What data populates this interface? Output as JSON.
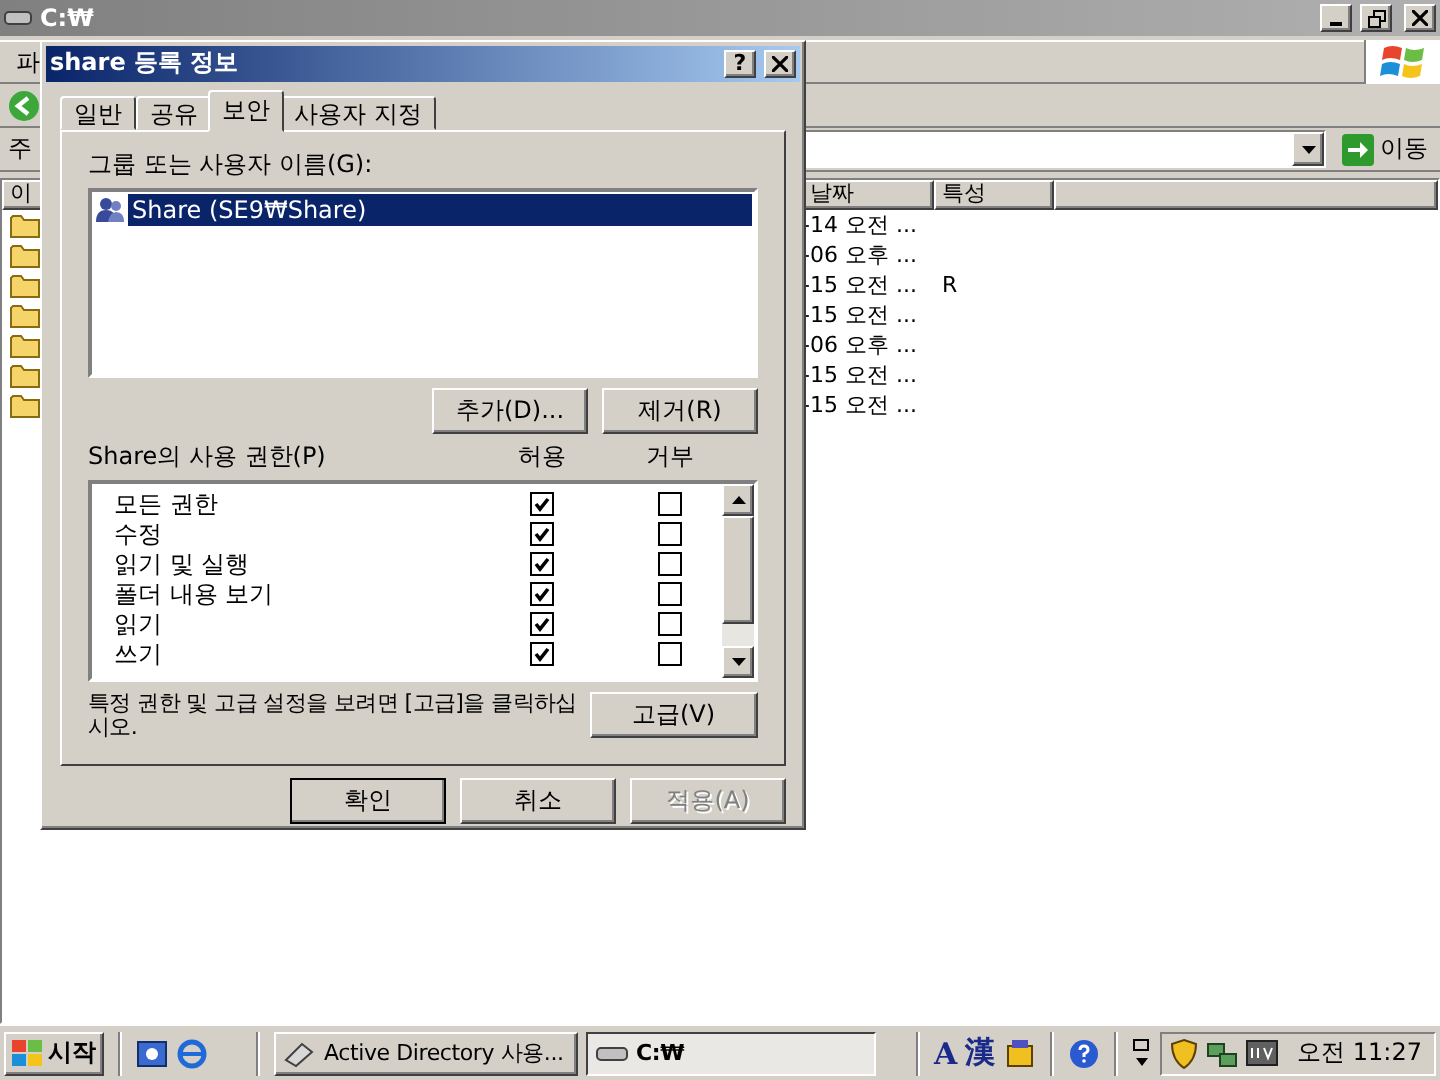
{
  "explorer": {
    "title": "C:₩",
    "menu_fragment": "파",
    "address_label": "주",
    "go_button": "이동",
    "columns": [
      {
        "label": "이"
      },
      {
        "label": "날짜"
      },
      {
        "label": "특성"
      }
    ],
    "rows": [
      {
        "date": "-14 오전 ..."
      },
      {
        "date": "-06 오후 ..."
      },
      {
        "date": "-15 오전 ...",
        "attributes": "R"
      },
      {
        "date": "-15 오전 ..."
      },
      {
        "date": "-06 오후 ..."
      },
      {
        "date": "-15 오전 ..."
      },
      {
        "date": "-15 오전 ..."
      }
    ]
  },
  "dialog": {
    "title": "share 등록 정보",
    "help_button": "?",
    "tabs": [
      {
        "label": "일반",
        "selected": false
      },
      {
        "label": "공유",
        "selected": false
      },
      {
        "label": "보안",
        "selected": true
      },
      {
        "label": "사용자 지정",
        "selected": false
      }
    ],
    "group_label": "그룹 또는 사용자 이름(G):",
    "users": [
      {
        "name": "Share (SE9₩Share)",
        "selected": true
      }
    ],
    "add_button": "추가(D)...",
    "remove_button": "제거(R)",
    "permissions_label": "Share의 사용 권한(P)",
    "allow_header": "허용",
    "deny_header": "거부",
    "permissions": [
      {
        "name": "모든 권한",
        "allow": true,
        "deny": false
      },
      {
        "name": "수정",
        "allow": true,
        "deny": false
      },
      {
        "name": "읽기 및 실행",
        "allow": true,
        "deny": false
      },
      {
        "name": "폴더 내용 보기",
        "allow": true,
        "deny": false
      },
      {
        "name": "읽기",
        "allow": true,
        "deny": false
      },
      {
        "name": "쓰기",
        "allow": true,
        "deny": false
      }
    ],
    "hint": "특정 권한 및 고급 설정을 보려면 [고급]을 클릭하십시오.",
    "advanced_button": "고급(V)",
    "buttons": [
      {
        "label": "확인",
        "kind": "default",
        "disabled": false
      },
      {
        "label": "취소",
        "kind": "normal",
        "disabled": false
      },
      {
        "label": "적용(A)",
        "kind": "normal",
        "disabled": true
      }
    ]
  },
  "taskbar": {
    "start_label": "시작",
    "tasks": [
      {
        "label": "Active Directory 사용...",
        "selected": false
      },
      {
        "label": "C:₩",
        "selected": true
      }
    ],
    "ime": [
      "A",
      "漢"
    ],
    "clock": "오전 11:27"
  }
}
